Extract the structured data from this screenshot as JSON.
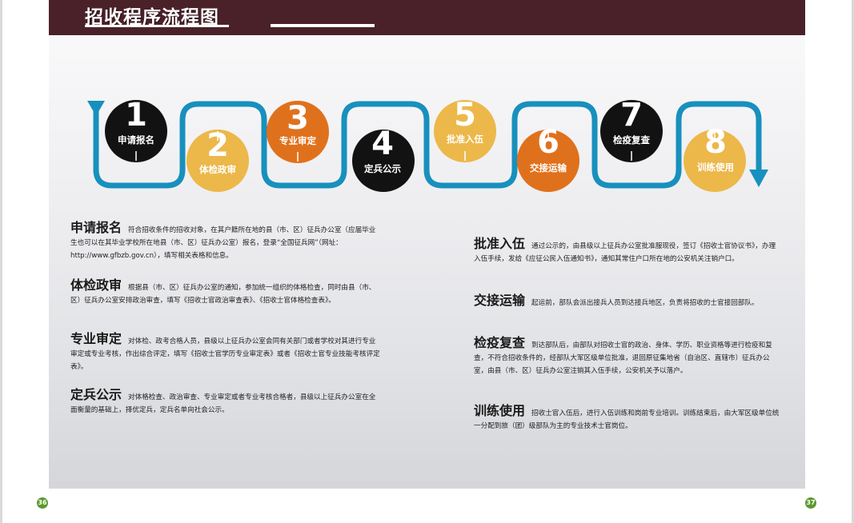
{
  "header": {
    "title": "招收程序流程图"
  },
  "steps": [
    {
      "num": "1",
      "label": "申请报名",
      "color": "#121212"
    },
    {
      "num": "2",
      "label": "体检政审",
      "color": "#ecb84a"
    },
    {
      "num": "3",
      "label": "专业审定",
      "color": "#e0711c"
    },
    {
      "num": "4",
      "label": "定兵公示",
      "color": "#121212"
    },
    {
      "num": "5",
      "label": "批准入伍",
      "color": "#ecb84a"
    },
    {
      "num": "6",
      "label": "交接运输",
      "color": "#e0711c"
    },
    {
      "num": "7",
      "label": "检疫复查",
      "color": "#121212"
    },
    {
      "num": "8",
      "label": "训练使用",
      "color": "#ecb84a"
    }
  ],
  "flow_color": "#1890bd",
  "descriptions": [
    {
      "head": "申请报名",
      "text": "符合招收条件的招收对象，在其户籍所在地的县（市、区）征兵办公室（应届毕业生也可以在其毕业学校所在地县（市、区）征兵办公室）报名，登录“全国征兵网”（网址：http://www.gfbzb.gov.cn），填写相关表格和信息。"
    },
    {
      "head": "体检政审",
      "text": "根据县（市、区）征兵办公室的通知，参加统一组织的体格检查，同时由县（市、区）征兵办公室安排政治审查，填写《招收士官政治审查表》、《招收士官体格检查表》。"
    },
    {
      "head": "专业审定",
      "text": "对体检、政考合格人员，县级以上征兵办公室会同有关部门或者学校对其进行专业审定或专业考核，作出综合评定，填写《招收士官学历专业审定表》或者《招收士官专业技能考核评定表》。"
    },
    {
      "head": "定兵公示",
      "text": "对体格检查、政治审查、专业审定或者专业考核合格者，县级以上征兵办公室在全面衡量的基础上，择优定兵，定兵名单向社会公示。"
    },
    {
      "head": "批准入伍",
      "text": "通过公示的，由县级以上征兵办公室批准服现役，签订《招收士官协议书》，办理入伍手续，发给《应征公民入伍通知书》，通知其常住户口所在地的公安机关注销户口。"
    },
    {
      "head": "交接运输",
      "text": "起运前，部队会派出接兵人员到达接兵地区，负责将招收的士官接回部队。"
    },
    {
      "head": "检疫复查",
      "text": "到达部队后，由部队对招收士官的政治、身体、学历、职业资格等进行检疫和复查，不符合招收条件的，经部队大军区级单位批准，退回原征集地省（自治区、直辖市）征兵办公室，由县（市、区）征兵办公室注销其入伍手续，公安机关予以落户。"
    },
    {
      "head": "训练使用",
      "text": "招收士官入伍后，进行入伍训练和岗前专业培训。训练结束后，由大军区级单位统一分配到旅（团）级部队为主的专业技术士官岗位。"
    }
  ],
  "page_numbers": {
    "left": "36",
    "right": "37"
  }
}
